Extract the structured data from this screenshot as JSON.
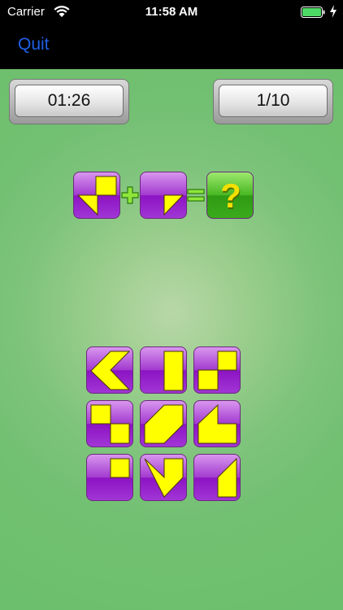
{
  "status_bar": {
    "carrier": "Carrier",
    "time": "11:58 AM"
  },
  "nav": {
    "quit_label": "Quit"
  },
  "hud": {
    "timer": "01:26",
    "level": "1/10"
  },
  "puzzle": {
    "question_mark": "?",
    "operators": [
      "plus",
      "equals"
    ]
  },
  "colors": {
    "tile_purple": "#a136d6",
    "tile_green": "#3aab1b",
    "shape_yellow": "#ffff00",
    "background": "#6cbf6c"
  }
}
